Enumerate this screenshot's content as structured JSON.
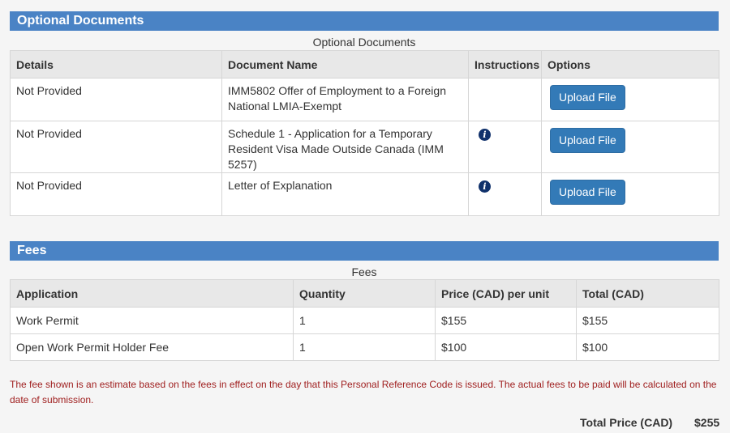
{
  "optional_documents": {
    "header": "Optional Documents",
    "caption": "Optional Documents",
    "columns": [
      "Details",
      "Document Name",
      "Instructions",
      "Options"
    ],
    "rows": [
      {
        "details": "Not Provided",
        "document_name": "IMM5802 Offer of Employment to a Foreign National LMIA-Exempt",
        "has_instructions": false,
        "option_label": "Upload File"
      },
      {
        "details": "Not Provided",
        "document_name": "Schedule 1 - Application for a Temporary Resident Visa Made Outside Canada (IMM 5257)",
        "has_instructions": true,
        "option_label": "Upload File"
      },
      {
        "details": "Not Provided",
        "document_name": "Letter of Explanation",
        "has_instructions": true,
        "option_label": "Upload File"
      }
    ],
    "instructions_icon": "info-icon"
  },
  "fees": {
    "header": "Fees",
    "caption": "Fees",
    "columns": [
      "Application",
      "Quantity",
      "Price (CAD) per unit",
      "Total (CAD)"
    ],
    "rows": [
      {
        "application": "Work Permit",
        "quantity": "1",
        "price": "$155",
        "total": "$155"
      },
      {
        "application": "Open Work Permit Holder Fee",
        "quantity": "1",
        "price": "$100",
        "total": "$100"
      }
    ],
    "disclaimer": "The fee shown is an estimate based on the fees in effect on the day that this Personal Reference Code is issued. The actual fees to be paid will be calculated on the date of submission.",
    "total_label": "Total Price (CAD)",
    "total_value": "$255"
  },
  "colors": {
    "header_bg": "#4a83c5",
    "button_bg": "#337ab7",
    "disclaimer_text": "#a02020",
    "info_icon": "#10316b"
  }
}
